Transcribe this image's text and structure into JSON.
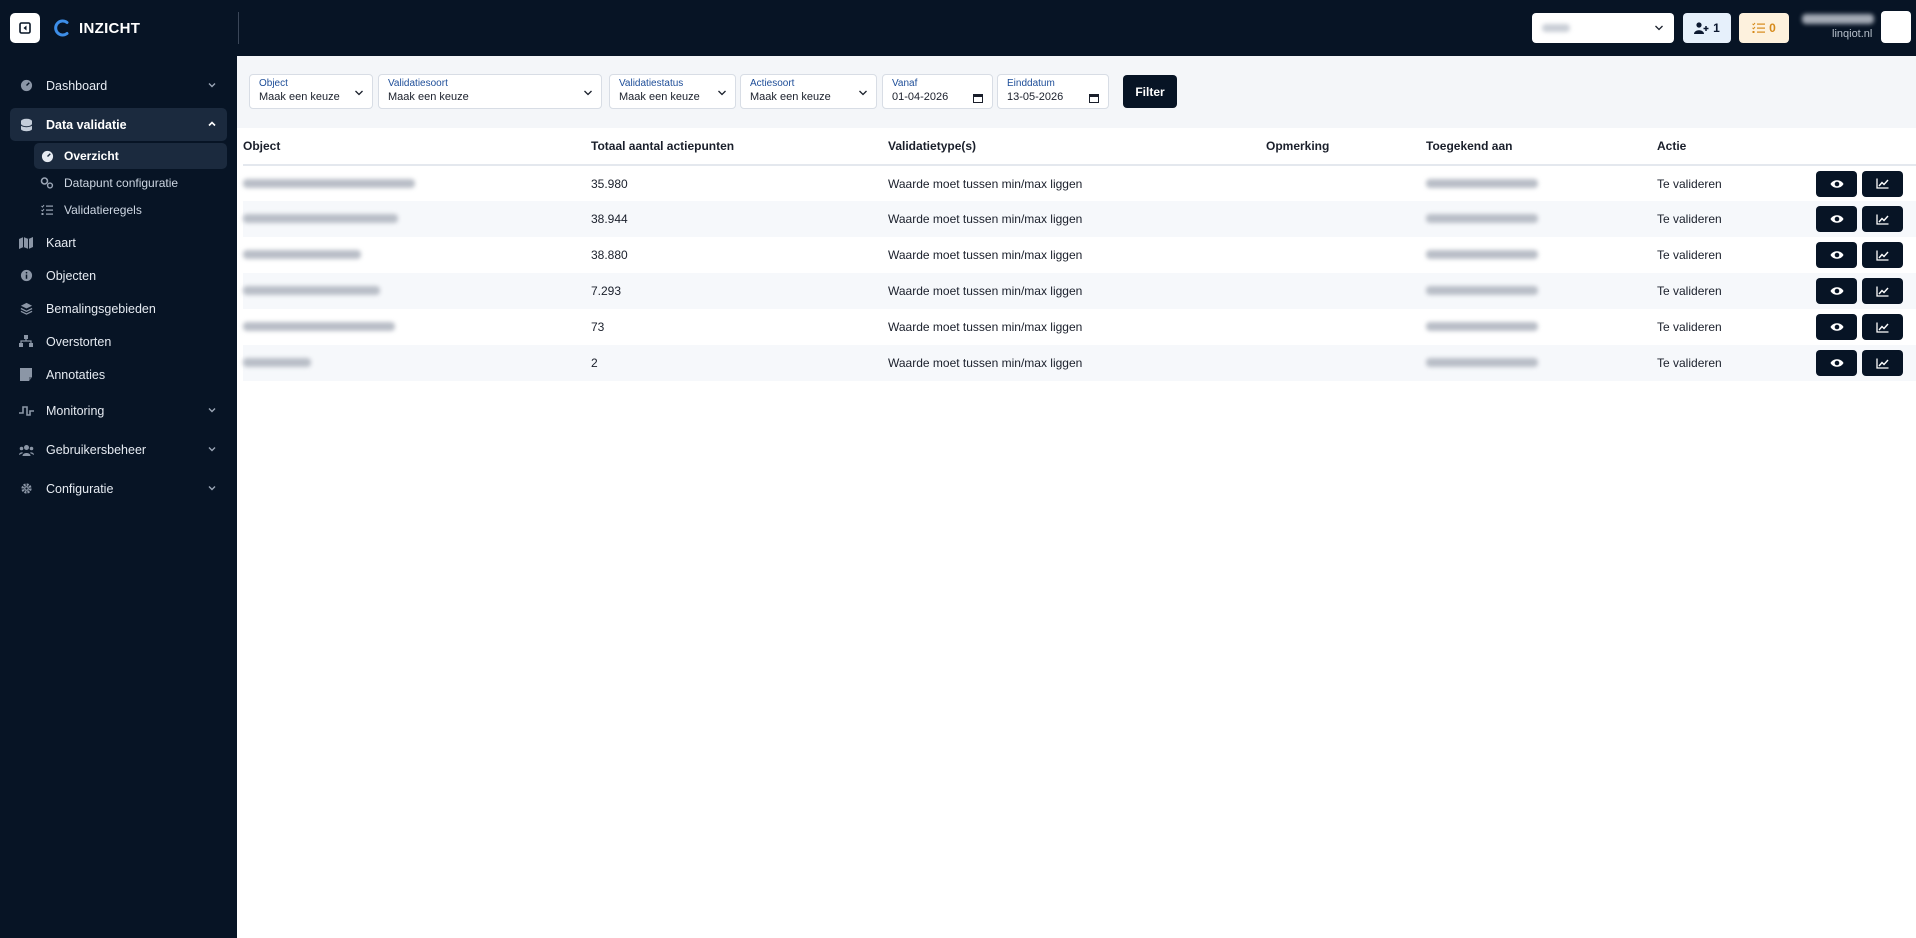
{
  "brand": {
    "name": "INZICHT"
  },
  "sidebar": {
    "items": [
      {
        "label": "Dashboard"
      },
      {
        "label": "Data validatie"
      },
      {
        "label": "Kaart"
      },
      {
        "label": "Objecten"
      },
      {
        "label": "Bemalingsgebieden"
      },
      {
        "label": "Overstorten"
      },
      {
        "label": "Annotaties"
      },
      {
        "label": "Monitoring"
      },
      {
        "label": "Gebruikersbeheer"
      },
      {
        "label": "Configuratie"
      }
    ],
    "sub_items": [
      {
        "label": "Overzicht"
      },
      {
        "label": "Datapunt configuratie"
      },
      {
        "label": "Validatieregels"
      }
    ]
  },
  "header": {
    "users_count": "1",
    "tasks_count": "0",
    "user_domain": "linqiot.nl"
  },
  "filters": {
    "object": {
      "label": "Object",
      "value": "Maak een keuze"
    },
    "validatiesoort": {
      "label": "Validatiesoort",
      "value": "Maak een keuze"
    },
    "validatiestatus": {
      "label": "Validatiestatus",
      "value": "Maak een keuze"
    },
    "actiesoort": {
      "label": "Actiesoort",
      "value": "Maak een keuze"
    },
    "vanaf": {
      "label": "Vanaf",
      "value": "01-04-2026"
    },
    "einddatum": {
      "label": "Einddatum",
      "value": "13-05-2026"
    },
    "button": "Filter"
  },
  "table": {
    "columns": [
      "Object",
      "Totaal aantal actiepunten",
      "Validatietype(s)",
      "Opmerking",
      "Toegekend aan",
      "Actie"
    ],
    "rows": [
      {
        "total": "35.980",
        "type": "Waarde moet tussen min/max liggen",
        "action": "Te valideren"
      },
      {
        "total": "38.944",
        "type": "Waarde moet tussen min/max liggen",
        "action": "Te valideren"
      },
      {
        "total": "38.880",
        "type": "Waarde moet tussen min/max liggen",
        "action": "Te valideren"
      },
      {
        "total": "7.293",
        "type": "Waarde moet tussen min/max liggen",
        "action": "Te valideren"
      },
      {
        "total": "73",
        "type": "Waarde moet tussen min/max liggen",
        "action": "Te valideren"
      },
      {
        "total": "2",
        "type": "Waarde moet tussen min/max liggen",
        "action": "Te valideren"
      }
    ]
  },
  "colors": {
    "navy": "#071425",
    "accent_blue": "#1d4d98",
    "warning": "#d68a1a"
  }
}
